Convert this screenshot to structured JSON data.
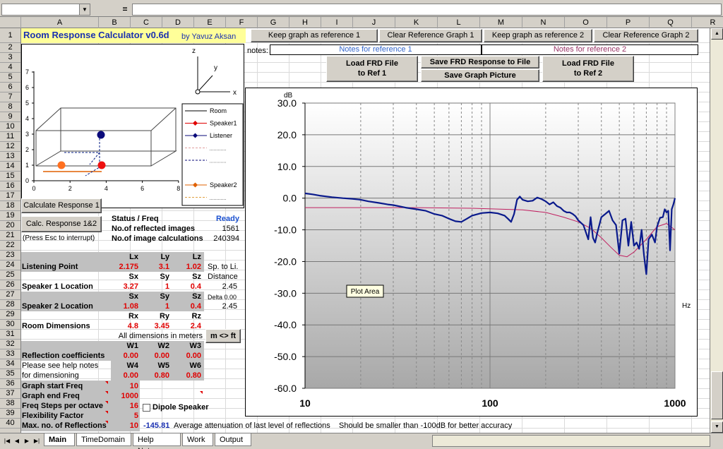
{
  "formula_bar": {
    "equals": "="
  },
  "columns": [
    "A",
    "B",
    "C",
    "D",
    "E",
    "F",
    "G",
    "H",
    "I",
    "J",
    "K",
    "L",
    "M",
    "N",
    "O",
    "P",
    "Q",
    "R"
  ],
  "rows": [
    "1",
    "2",
    "3",
    "4",
    "5",
    "6",
    "7",
    "8",
    "9",
    "10",
    "11",
    "12",
    "13",
    "14",
    "15",
    "16",
    "17",
    "18",
    "19",
    "20",
    "21",
    "22",
    "23",
    "24",
    "25",
    "26",
    "27",
    "28",
    "29",
    "30",
    "31",
    "32",
    "33",
    "34",
    "35",
    "36",
    "37",
    "38",
    "39",
    "40"
  ],
  "title": {
    "name": "Room Response Calculator  v0.6d",
    "author": "by Yavuz Aksan"
  },
  "ref_buttons": {
    "keep1": "Keep graph as reference 1",
    "clear1": "Clear Reference Graph 1",
    "keep2": "Keep graph as reference 2",
    "clear2": "Clear Reference Graph 2"
  },
  "notes": {
    "label": "notes:",
    "ref1": "Notes for reference 1",
    "ref2": "Notes for reference 2",
    "ref1_color": "#3366cc",
    "ref2_color": "#993366"
  },
  "file_buttons": {
    "load1": [
      "Load FRD File",
      "to Ref 1"
    ],
    "save_frd": "Save FRD Response to File",
    "save_pic": "Save Graph Picture",
    "load2": [
      "Load FRD File",
      "to Ref 2"
    ]
  },
  "room_plot": {
    "x_ticks": [
      "0",
      "2",
      "4",
      "6",
      "8"
    ],
    "y_ticks": [
      "0",
      "1",
      "2",
      "3",
      "4",
      "5",
      "6",
      "7"
    ],
    "axes": {
      "x": "x",
      "y": "y",
      "z": "z"
    },
    "legend": [
      "Room",
      "Speaker1",
      "Listener",
      "",
      "",
      "",
      "Speaker2",
      ""
    ]
  },
  "controls": {
    "calc1": "Calculate Response 1",
    "calc12": "Calc. Response 1&2",
    "esc_hint": "(Press Esc to interrupt)"
  },
  "status": {
    "label": "Status / Freq",
    "value": "Ready",
    "reflected_label": "No.of reflected images",
    "reflected_value": "1561",
    "calc_label": "No.of image calculations",
    "calc_value": "240394"
  },
  "table": {
    "listening": {
      "h": [
        "Lx",
        "Ly",
        "Lz"
      ],
      "label": "Listening Point",
      "v": [
        "2.175",
        "3.1",
        "1.02"
      ],
      "side": "Sp. to Li."
    },
    "speaker1": {
      "h": [
        "Sx",
        "Sy",
        "Sz"
      ],
      "label": "Speaker 1 Location",
      "v": [
        "3.27",
        "1",
        "0.4"
      ],
      "side_label": "Distance",
      "side_value": "2.45"
    },
    "speaker2": {
      "h": [
        "Sx",
        "Sy",
        "Sz"
      ],
      "label": "Speaker 2 Location",
      "v": [
        "1.08",
        "1",
        "0.4"
      ],
      "side_label": "Delta 0.00",
      "side_value": "2.45"
    },
    "room": {
      "h": [
        "Rx",
        "Ry",
        "Rz"
      ],
      "label": "Room Dimensions",
      "v": [
        "4.8",
        "3.45",
        "2.4"
      ]
    },
    "meters_note": "All dimensions in meters",
    "unit_button": "m <> ft",
    "refl": {
      "h": [
        "W1",
        "W2",
        "W3"
      ],
      "label": "Reflection coefficients",
      "v": [
        "0.00",
        "0.00",
        "0.00"
      ]
    },
    "refl2": {
      "h": [
        "W4",
        "W5",
        "W6"
      ],
      "note1": "Please see help notes",
      "note2": "for dimensioning",
      "v": [
        "0.00",
        "0.80",
        "0.80"
      ]
    }
  },
  "params": [
    {
      "label": "Graph start Freq",
      "value": "10"
    },
    {
      "label": "Graph end Freq",
      "value": "1000"
    },
    {
      "label": "Freq Steps per octave",
      "value": "16"
    },
    {
      "label": "Flexibility Factor",
      "value": "5"
    },
    {
      "label": "Max. no. of Reflections",
      "value": "10"
    }
  ],
  "dipole": {
    "label": "Dipole Speaker",
    "checked": false
  },
  "attenuation": {
    "value": "-145.81",
    "text": "Average attenuation of last level of reflections",
    "hint": "Should be smaller than -100dB for better accuracy"
  },
  "tabs": [
    "Main",
    "TimeDomain",
    "Help Notes",
    "Work",
    "Output"
  ],
  "active_tab": "Main",
  "chart_data": {
    "type": "line",
    "ylabel": "dB",
    "xlabel": "Hz",
    "xscale": "log",
    "xlim": [
      10,
      1000
    ],
    "ylim": [
      -60,
      30
    ],
    "y_ticks": [
      "30.0",
      "20.0",
      "10.0",
      "0.0",
      "-10.0",
      "-20.0",
      "-30.0",
      "-40.0",
      "-50.0",
      "-60.0"
    ],
    "x_ticks": [
      "10",
      "100",
      "1000"
    ],
    "tooltip": "Plot Area",
    "colors": {
      "main": "#0a1a8c",
      "ref": "#c02060"
    },
    "series": [
      {
        "x": [
          10,
          11,
          12,
          14,
          16,
          18,
          20,
          22,
          25,
          28,
          30,
          35,
          40,
          45,
          50,
          55,
          60,
          65,
          70,
          75,
          80,
          90,
          100,
          110,
          120,
          125,
          130,
          135,
          140,
          145,
          150,
          160,
          170,
          180,
          190,
          200,
          210,
          220,
          230,
          240,
          250,
          260,
          270,
          280,
          290,
          300,
          320,
          340,
          350,
          360,
          370,
          380,
          400,
          420,
          440,
          460,
          480,
          500,
          520,
          540,
          560,
          580,
          600,
          620,
          640,
          660,
          680,
          700,
          720,
          750,
          780,
          800,
          830,
          860,
          880,
          900,
          920,
          940,
          960,
          980,
          1000
        ],
        "y": [
          1.5,
          1.2,
          0.8,
          0.3,
          0,
          -0.2,
          -0.5,
          -1,
          -1.5,
          -2,
          -2.2,
          -3,
          -3.5,
          -4,
          -5,
          -5.5,
          -6.5,
          -7.3,
          -7.5,
          -6.5,
          -5.5,
          -4.7,
          -4.5,
          -4.8,
          -5.5,
          -6.5,
          -7.5,
          -5,
          -0.5,
          0.5,
          -0.5,
          -1,
          -0.8,
          0.2,
          -0.3,
          -1,
          -2,
          -1.3,
          -2.5,
          -3,
          -4,
          -4.5,
          -4.5,
          -5,
          -5.7,
          -7,
          -8.5,
          -13,
          -6,
          -12.5,
          -14,
          -11,
          -6,
          -5,
          -4,
          -7,
          -8.5,
          -17.5,
          -7,
          -6.5,
          -15,
          -7.5,
          -15,
          -14,
          -16,
          -10,
          -18,
          -24,
          -13,
          -11.5,
          -14,
          -9,
          -6.2,
          -6,
          -3.5,
          -4.5,
          -4,
          -16.5,
          -3.5,
          -2,
          0
        ]
      },
      {
        "x": [
          10,
          20,
          40,
          80,
          150,
          200,
          250,
          300,
          350,
          400,
          450,
          500,
          550,
          600,
          700,
          800,
          900,
          1000
        ],
        "y": [
          -3,
          -3,
          -3,
          -3.2,
          -3.7,
          -4.5,
          -6,
          -7.5,
          -9.5,
          -12.5,
          -15.5,
          -18,
          -18.5,
          -17,
          -13,
          -9,
          -8,
          -10
        ]
      }
    ]
  }
}
